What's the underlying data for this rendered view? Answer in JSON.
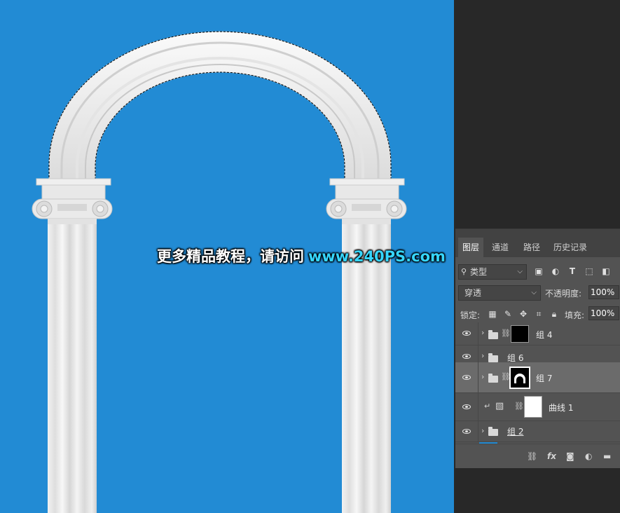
{
  "canvas": {
    "background_color": "#228bd4",
    "watermark_text": "更多精品教程，请访问",
    "watermark_url": "www.240PS.com"
  },
  "layers_panel": {
    "tabs": [
      {
        "label": "图层",
        "active": true
      },
      {
        "label": "通道",
        "active": false
      },
      {
        "label": "路径",
        "active": false
      },
      {
        "label": "历史记录",
        "active": false
      }
    ],
    "filter": {
      "label": "类型"
    },
    "blend_mode": "穿透",
    "opacity_label": "不透明度:",
    "opacity_value": "100%",
    "lock_label": "锁定:",
    "fill_label": "填充:",
    "fill_value": "100%",
    "layers": [
      {
        "name": "组 4",
        "type": "group",
        "mask": "black",
        "selected": false
      },
      {
        "name": "组 6",
        "type": "group",
        "mask": "none",
        "selected": false
      },
      {
        "name": "组 7",
        "type": "group",
        "mask": "arch",
        "selected": true
      },
      {
        "name": "曲线 1",
        "type": "adjustment",
        "mask": "white",
        "selected": false
      },
      {
        "name": "组 2",
        "type": "group",
        "mask": "none",
        "selected": false
      }
    ],
    "bottom_icons": [
      "link-icon",
      "fx-icon",
      "mask-icon",
      "adjustment-icon",
      "new-group-icon"
    ]
  }
}
